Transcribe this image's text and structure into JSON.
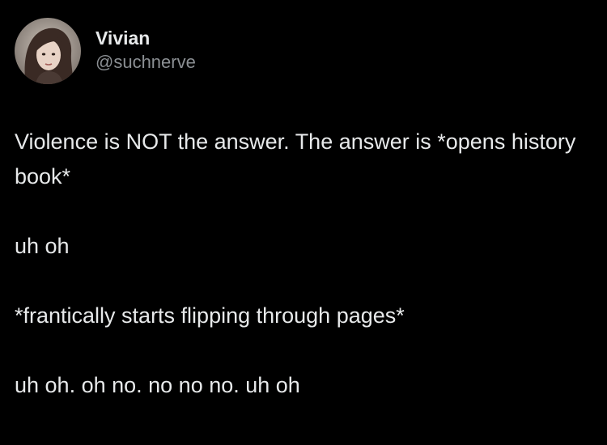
{
  "tweet": {
    "author": {
      "display_name": "Vivian",
      "handle": "@suchnerve",
      "avatar_icon": "user-avatar-photo"
    },
    "paragraphs": [
      "Violence is NOT the answer. The answer is *opens history book*",
      "uh oh",
      "*frantically starts flipping through pages*",
      "uh oh. oh no. no no no. uh oh"
    ]
  },
  "colors": {
    "background": "#000000",
    "text_primary": "#e7e9ea",
    "text_secondary": "#8b8f93"
  }
}
